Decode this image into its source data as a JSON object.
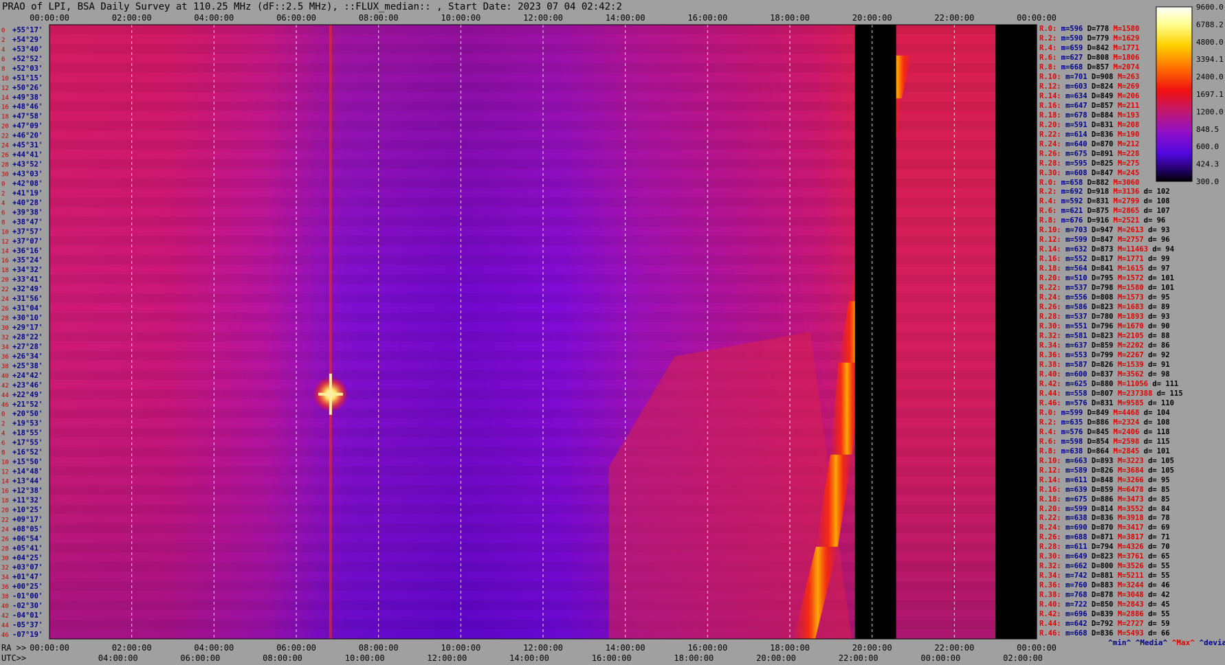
{
  "title": "PRAO of LPI, BSA Daily Survey at 110.25 MHz (dF::2.5 MHz), ::FLUX_median:: , Start Date: 2023 07 04 02:42:2",
  "chart_data": {
    "type": "heatmap",
    "title": "PRAO of LPI, BSA Daily Survey at 110.25 MHz (dF::2.5 MHz), ::FLUX_median:: , Start Date: 2023 07 04 02:42:2",
    "x_top_ticks": [
      "00:00:00",
      "02:00:00",
      "04:00:00",
      "06:00:00",
      "08:00:00",
      "10:00:00",
      "12:00:00",
      "14:00:00",
      "16:00:00",
      "18:00:00",
      "20:00:00",
      "22:00:00",
      "00:00:00"
    ],
    "x_bottom_ra_label": "RA >>",
    "x_bottom_ra_ticks": [
      "00:00:00",
      "02:00:00",
      "04:00:00",
      "06:00:00",
      "08:00:00",
      "10:00:00",
      "12:00:00",
      "14:00:00",
      "16:00:00",
      "18:00:00",
      "20:00:00",
      "22:00:00",
      "00:00:00"
    ],
    "x_bottom_utc_label": "UTC>>",
    "x_bottom_utc_ticks": [
      "04:00:00",
      "06:00:00",
      "08:00:00",
      "10:00:00",
      "12:00:00",
      "14:00:00",
      "16:00:00",
      "18:00:00",
      "20:00:00",
      "22:00:00",
      "00:00:00",
      "02:00:00"
    ],
    "y_labels": [
      "+55°17'",
      "+54°29'",
      "+53°40'",
      "+52°52'",
      "+52°03'",
      "+51°15'",
      "+50°26'",
      "+49°38'",
      "+48°46'",
      "+47°58'",
      "+47°09'",
      "+46°20'",
      "+45°31'",
      "+44°41'",
      "+43°52'",
      "+43°03'",
      "+42°08'",
      "+41°19'",
      "+40°28'",
      "+39°38'",
      "+38°47'",
      "+37°57'",
      "+37°07'",
      "+36°16'",
      "+35°24'",
      "+34°32'",
      "+33°41'",
      "+32°49'",
      "+31°56'",
      "+31°04'",
      "+30°10'",
      "+29°17'",
      "+28°22'",
      "+27°28'",
      "+26°34'",
      "+25°38'",
      "+24°42'",
      "+23°46'",
      "+22°49'",
      "+21°52'",
      "+20°50'",
      "+19°53'",
      "+18°55'",
      "+17°55'",
      "+16°52'",
      "+15°50'",
      "+14°48'",
      "+13°44'",
      "+12°38'",
      "+11°32'",
      "+10°25'",
      "+09°17'",
      "+08°05'",
      "+06°54'",
      "+05°41'",
      "+04°25'",
      "+03°07'",
      "+01°47'",
      "+00°25'",
      "-01°00'",
      "-02°30'",
      "-04°01'",
      "-05°37'",
      "-07°19'"
    ],
    "y_index_labels": [
      "0",
      "2",
      "4",
      "6",
      "8",
      "10",
      "12",
      "14",
      "16",
      "18",
      "20",
      "22",
      "24",
      "26",
      "28",
      "30",
      "0",
      "2",
      "4",
      "6",
      "8",
      "10",
      "12",
      "14",
      "16",
      "18",
      "20",
      "22",
      "24",
      "26",
      "28",
      "30",
      "32",
      "34",
      "36",
      "38",
      "40",
      "42",
      "44",
      "46",
      "0",
      "2",
      "4",
      "6",
      "8",
      "10",
      "12",
      "14",
      "16",
      "18",
      "20",
      "22",
      "24",
      "26",
      "28",
      "30",
      "32",
      "34",
      "36",
      "38",
      "40",
      "42",
      "44",
      "46"
    ],
    "colorbar_ticks": [
      "9600.0",
      "6788.2",
      "4800.0",
      "3394.1",
      "2400.0",
      "1697.1",
      "1200.0",
      "848.5",
      "600.0",
      "424.3",
      "300.0"
    ],
    "features": {
      "point_source": {
        "utc": "06:50",
        "row": "+22°49'"
      },
      "blanked_intervals_utc": [
        [
          "19:35",
          "20:35"
        ],
        [
          "23:00",
          "24:00"
        ]
      ],
      "bright_ridge": "diagonal ridge from ~18:30 at -07°19' to ~21:00 at +46°20'"
    }
  },
  "row_stats": [
    {
      "r": "R.0:",
      "m": "m=596",
      "d": "D=778",
      "x": "M=1580",
      "dev": ""
    },
    {
      "r": "R.2:",
      "m": "m=590",
      "d": "D=779",
      "x": "M=1629",
      "dev": ""
    },
    {
      "r": "R.4:",
      "m": "m=659",
      "d": "D=842",
      "x": "M=1771",
      "dev": ""
    },
    {
      "r": "R.6:",
      "m": "m=627",
      "d": "D=808",
      "x": "M=1806",
      "dev": ""
    },
    {
      "r": "R.8:",
      "m": "m=668",
      "d": "D=857",
      "x": "M=2074",
      "dev": ""
    },
    {
      "r": "R.10:",
      "m": "m=701",
      "d": "D=908",
      "x": "M=263",
      "dev": ""
    },
    {
      "r": "R.12:",
      "m": "m=603",
      "d": "D=824",
      "x": "M=269",
      "dev": ""
    },
    {
      "r": "R.14:",
      "m": "m=634",
      "d": "D=849",
      "x": "M=206",
      "dev": ""
    },
    {
      "r": "R.16:",
      "m": "m=647",
      "d": "D=857",
      "x": "M=211",
      "dev": ""
    },
    {
      "r": "R.18:",
      "m": "m=678",
      "d": "D=884",
      "x": "M=193",
      "dev": ""
    },
    {
      "r": "R.20:",
      "m": "m=591",
      "d": "D=831",
      "x": "M=208",
      "dev": ""
    },
    {
      "r": "R.22:",
      "m": "m=614",
      "d": "D=836",
      "x": "M=190",
      "dev": ""
    },
    {
      "r": "R.24:",
      "m": "m=640",
      "d": "D=870",
      "x": "M=212",
      "dev": ""
    },
    {
      "r": "R.26:",
      "m": "m=675",
      "d": "D=891",
      "x": "M=228",
      "dev": ""
    },
    {
      "r": "R.28:",
      "m": "m=595",
      "d": "D=825",
      "x": "M=275",
      "dev": ""
    },
    {
      "r": "R.30:",
      "m": "m=608",
      "d": "D=847",
      "x": "M=245",
      "dev": ""
    },
    {
      "r": "R.0:",
      "m": "m=658",
      "d": "D=882",
      "x": "M=3060",
      "dev": ""
    },
    {
      "r": "R.2:",
      "m": "m=692",
      "d": "D=918",
      "x": "M=3136",
      "dev": "d= 102"
    },
    {
      "r": "R.4:",
      "m": "m=592",
      "d": "D=831",
      "x": "M=2799",
      "dev": "d= 108"
    },
    {
      "r": "R.6:",
      "m": "m=621",
      "d": "D=875",
      "x": "M=2865",
      "dev": "d= 107"
    },
    {
      "r": "R.8:",
      "m": "m=676",
      "d": "D=916",
      "x": "M=2521",
      "dev": "d= 96"
    },
    {
      "r": "R.10:",
      "m": "m=703",
      "d": "D=947",
      "x": "M=2613",
      "dev": "d= 93"
    },
    {
      "r": "R.12:",
      "m": "m=599",
      "d": "D=847",
      "x": "M=2757",
      "dev": "d= 96"
    },
    {
      "r": "R.14:",
      "m": "m=632",
      "d": "D=873",
      "x": "M=11463",
      "dev": "d= 94"
    },
    {
      "r": "R.16:",
      "m": "m=552",
      "d": "D=817",
      "x": "M=1771",
      "dev": "d= 99"
    },
    {
      "r": "R.18:",
      "m": "m=564",
      "d": "D=841",
      "x": "M=1615",
      "dev": "d= 97"
    },
    {
      "r": "R.20:",
      "m": "m=510",
      "d": "D=795",
      "x": "M=1572",
      "dev": "d= 101"
    },
    {
      "r": "R.22:",
      "m": "m=537",
      "d": "D=798",
      "x": "M=1580",
      "dev": "d= 101"
    },
    {
      "r": "R.24:",
      "m": "m=556",
      "d": "D=808",
      "x": "M=1573",
      "dev": "d= 95"
    },
    {
      "r": "R.26:",
      "m": "m=586",
      "d": "D=823",
      "x": "M=1683",
      "dev": "d= 89"
    },
    {
      "r": "R.28:",
      "m": "m=537",
      "d": "D=780",
      "x": "M=1893",
      "dev": "d= 93"
    },
    {
      "r": "R.30:",
      "m": "m=551",
      "d": "D=796",
      "x": "M=1670",
      "dev": "d= 90"
    },
    {
      "r": "R.32:",
      "m": "m=581",
      "d": "D=823",
      "x": "M=2105",
      "dev": "d= 88"
    },
    {
      "r": "R.34:",
      "m": "m=637",
      "d": "D=859",
      "x": "M=2202",
      "dev": "d= 86"
    },
    {
      "r": "R.36:",
      "m": "m=553",
      "d": "D=799",
      "x": "M=2267",
      "dev": "d= 92"
    },
    {
      "r": "R.38:",
      "m": "m=587",
      "d": "D=826",
      "x": "M=1539",
      "dev": "d= 91"
    },
    {
      "r": "R.40:",
      "m": "m=600",
      "d": "D=837",
      "x": "M=3562",
      "dev": "d= 98"
    },
    {
      "r": "R.42:",
      "m": "m=625",
      "d": "D=880",
      "x": "M=11056",
      "dev": "d= 111"
    },
    {
      "r": "R.44:",
      "m": "m=558",
      "d": "D=807",
      "x": "M=237388",
      "dev": "d= 115"
    },
    {
      "r": "R.46:",
      "m": "m=576",
      "d": "D=831",
      "x": "M=9585",
      "dev": "d= 110"
    },
    {
      "r": "R.0:",
      "m": "m=599",
      "d": "D=849",
      "x": "M=4468",
      "dev": "d= 104"
    },
    {
      "r": "R.2:",
      "m": "m=635",
      "d": "D=886",
      "x": "M=2324",
      "dev": "d= 108"
    },
    {
      "r": "R.4:",
      "m": "m=576",
      "d": "D=845",
      "x": "M=2406",
      "dev": "d= 118"
    },
    {
      "r": "R.6:",
      "m": "m=598",
      "d": "D=854",
      "x": "M=2598",
      "dev": "d= 115"
    },
    {
      "r": "R.8:",
      "m": "m=638",
      "d": "D=864",
      "x": "M=2845",
      "dev": "d= 101"
    },
    {
      "r": "R.10:",
      "m": "m=663",
      "d": "D=893",
      "x": "M=3223",
      "dev": "d= 105"
    },
    {
      "r": "R.12:",
      "m": "m=589",
      "d": "D=826",
      "x": "M=3684",
      "dev": "d= 105"
    },
    {
      "r": "R.14:",
      "m": "m=611",
      "d": "D=848",
      "x": "M=3266",
      "dev": "d= 95"
    },
    {
      "r": "R.16:",
      "m": "m=639",
      "d": "D=859",
      "x": "M=6478",
      "dev": "d= 85"
    },
    {
      "r": "R.18:",
      "m": "m=675",
      "d": "D=886",
      "x": "M=3473",
      "dev": "d= 85"
    },
    {
      "r": "R.20:",
      "m": "m=599",
      "d": "D=814",
      "x": "M=3552",
      "dev": "d= 84"
    },
    {
      "r": "R.22:",
      "m": "m=638",
      "d": "D=836",
      "x": "M=3918",
      "dev": "d= 78"
    },
    {
      "r": "R.24:",
      "m": "m=690",
      "d": "D=870",
      "x": "M=3417",
      "dev": "d= 69"
    },
    {
      "r": "R.26:",
      "m": "m=688",
      "d": "D=871",
      "x": "M=3817",
      "dev": "d= 71"
    },
    {
      "r": "R.28:",
      "m": "m=611",
      "d": "D=794",
      "x": "M=4326",
      "dev": "d= 70"
    },
    {
      "r": "R.30:",
      "m": "m=649",
      "d": "D=823",
      "x": "M=3761",
      "dev": "d= 65"
    },
    {
      "r": "R.32:",
      "m": "m=662",
      "d": "D=800",
      "x": "M=3526",
      "dev": "d= 55"
    },
    {
      "r": "R.34:",
      "m": "m=742",
      "d": "D=881",
      "x": "M=5211",
      "dev": "d= 55"
    },
    {
      "r": "R.36:",
      "m": "m=760",
      "d": "D=883",
      "x": "M=3244",
      "dev": "d= 46"
    },
    {
      "r": "R.38:",
      "m": "m=768",
      "d": "D=878",
      "x": "M=3048",
      "dev": "d= 42"
    },
    {
      "r": "R.40:",
      "m": "m=722",
      "d": "D=850",
      "x": "M=2843",
      "dev": "d= 45"
    },
    {
      "r": "R.42:",
      "m": "m=696",
      "d": "D=839",
      "x": "M=2886",
      "dev": "d= 55"
    },
    {
      "r": "R.44:",
      "m": "m=642",
      "d": "D=792",
      "x": "M=2727",
      "dev": "d= 59"
    },
    {
      "r": "R.46:",
      "m": "m=668",
      "d": "D=836",
      "x": "M=5493",
      "dev": "d= 66"
    }
  ],
  "legend": {
    "min": "^min^",
    "median": "^Media^",
    "max": "^Max^",
    "devia": "^devia^"
  },
  "colors": {
    "background": "#a0a0a0",
    "axis_text": "#00008b",
    "label_red": "#e00000"
  }
}
